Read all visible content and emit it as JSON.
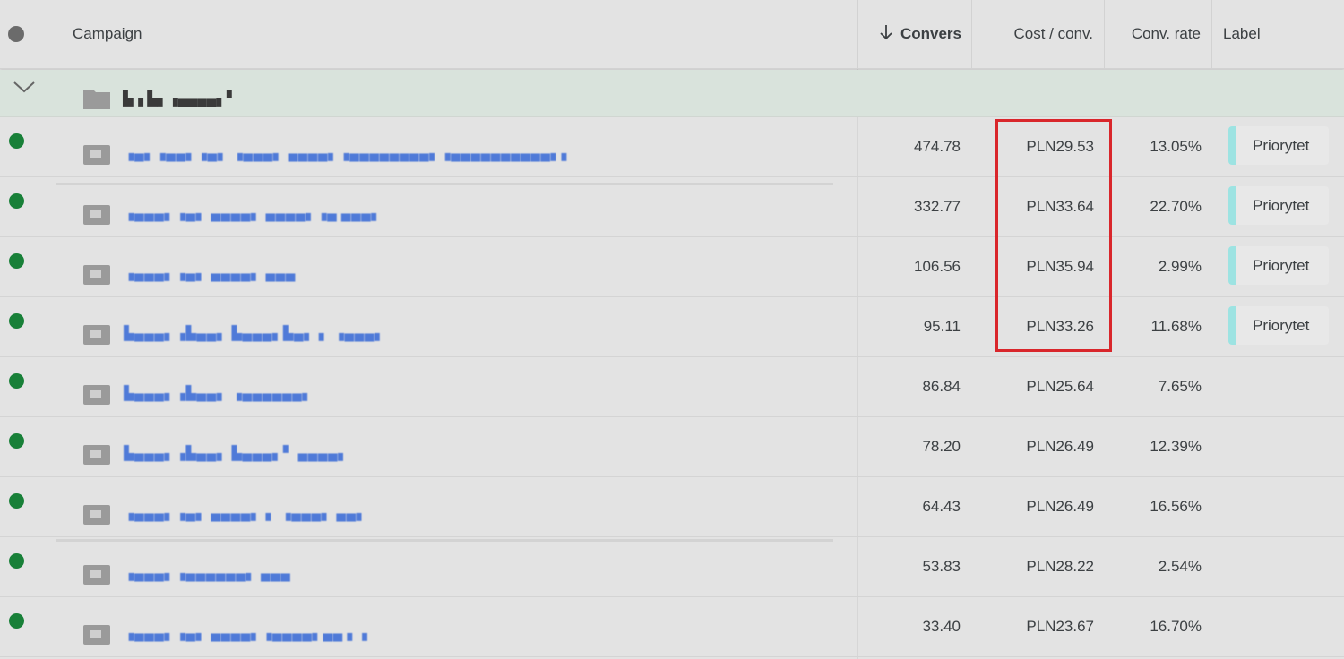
{
  "header": {
    "campaign": "Campaign",
    "conversions": "Convers",
    "sort_icon": "arrow-down-icon",
    "cost_per_conv": "Cost / conv.",
    "conv_rate": "Conv. rate",
    "label": "Label"
  },
  "group": {
    "name": "▙▗ ▙▖▗▄▄▄▄▖▘",
    "icon": "folder-icon",
    "expand_icon": "chevron-down-icon"
  },
  "rows": [
    {
      "name": "▗▄▖▗▄▄▖▗▄▖ ▗▄▄▄▖ ▄▄▄▄▖▗▄▄▄▄▄▄▄▄▖▗▄▄▄▄▄▄▄▄▄▄▖▖",
      "conversions": "474.78",
      "cost": "PLN29.53",
      "rate": "13.05%",
      "label": "Priorytet",
      "status_color": "#188038"
    },
    {
      "name": "▗▄▄▄▖▗▄▖ ▄▄▄▄▖ ▄▄▄▄▖▗▄ ▄▄▄▖",
      "conversions": "332.77",
      "cost": "PLN33.64",
      "rate": "22.70%",
      "label": "Priorytet",
      "status_color": "#188038"
    },
    {
      "name": "▗▄▄▄▖▗▄▖ ▄▄▄▄▖ ▄▄▄",
      "conversions": "106.56",
      "cost": "PLN35.94",
      "rate": "2.99%",
      "label": "Priorytet",
      "status_color": "#188038"
    },
    {
      "name": "▙▄▄▄▖▗▙▄▄▖ ▙▄▄▄▖▙▄▖ ▖ ▗▄▄▄▖",
      "conversions": "95.11",
      "cost": "PLN33.26",
      "rate": "11.68%",
      "label": "Priorytet",
      "status_color": "#188038"
    },
    {
      "name": "▙▄▄▄▖▗▙▄▄▖ ▗▄▄▄▄▄▄▖",
      "conversions": "86.84",
      "cost": "PLN25.64",
      "rate": "7.65%",
      "label": "",
      "status_color": "#188038"
    },
    {
      "name": "▙▄▄▄▖▗▙▄▄▖ ▙▄▄▄▖▘ ▄▄▄▄▖",
      "conversions": "78.20",
      "cost": "PLN26.49",
      "rate": "12.39%",
      "label": "",
      "status_color": "#188038"
    },
    {
      "name": "▗▄▄▄▖▗▄▖ ▄▄▄▄▖ ▖ ▗▄▄▄▖ ▄▄▖",
      "conversions": "64.43",
      "cost": "PLN26.49",
      "rate": "16.56%",
      "label": "",
      "status_color": "#188038"
    },
    {
      "name": "▗▄▄▄▖▗▄▄▄▄▄▄▖ ▄▄▄",
      "conversions": "53.83",
      "cost": "PLN28.22",
      "rate": "2.54%",
      "label": "",
      "status_color": "#188038"
    },
    {
      "name": "▗▄▄▄▖▗▄▖ ▄▄▄▄▖▗▄▄▄▄▖▄▄ ▖ ▖",
      "conversions": "33.40",
      "cost": "PLN23.67",
      "rate": "16.70%",
      "label": "",
      "status_color": "#188038"
    }
  ]
}
